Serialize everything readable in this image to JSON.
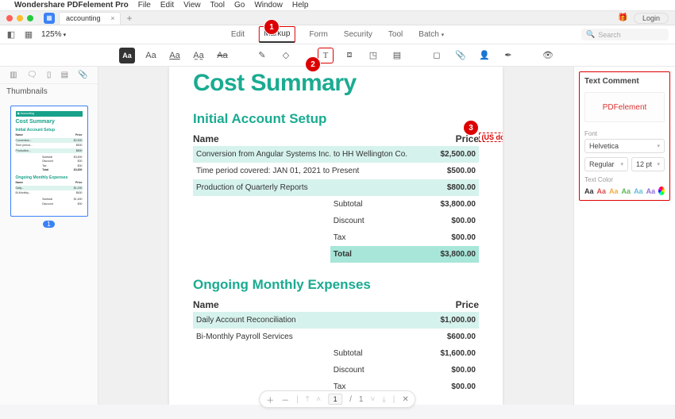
{
  "menubar": {
    "appName": "Wondershare PDFelement Pro",
    "items": [
      "File",
      "Edit",
      "View",
      "Tool",
      "Go",
      "Window",
      "Help"
    ]
  },
  "titlebar": {
    "tabName": "accounting",
    "loginLabel": "Login"
  },
  "toolbar": {
    "zoom": "125%",
    "tabs": [
      "Edit",
      "Markup",
      "Form",
      "Security",
      "Tool",
      "Batch"
    ],
    "activeTab": "Markup",
    "searchPlaceholder": "Search"
  },
  "leftPane": {
    "title": "Thumbnails",
    "pageBadge": "1"
  },
  "document": {
    "title": "Cost Summary",
    "section1": {
      "heading": "Initial Account Setup",
      "colName": "Name",
      "colPrice": "Price",
      "annotation": "(US dollar)",
      "rows": [
        {
          "name": "Conversion from Angular Systems Inc. to HH Wellington Co.",
          "price": "$2,500.00"
        },
        {
          "name": "Time period covered: JAN 01, 2021 to Present",
          "price": "$500.00"
        },
        {
          "name": "Production of Quarterly Reports",
          "price": "$800.00"
        }
      ],
      "totals": [
        {
          "label": "Subtotal",
          "value": "$3,800.00"
        },
        {
          "label": "Discount",
          "value": "$00.00"
        },
        {
          "label": "Tax",
          "value": "$00.00"
        },
        {
          "label": "Total",
          "value": "$3,800.00"
        }
      ]
    },
    "section2": {
      "heading": "Ongoing Monthly Expenses",
      "colName": "Name",
      "colPrice": "Price",
      "rows": [
        {
          "name": "Daily Account Reconciliation",
          "price": "$1,000.00"
        },
        {
          "name": "Bi-Monthly Payroll Services",
          "price": "$600.00"
        }
      ],
      "totals": [
        {
          "label": "Subtotal",
          "value": "$1,600.00"
        },
        {
          "label": "Discount",
          "value": "$00.00"
        },
        {
          "label": "Tax",
          "value": "$00.00"
        }
      ]
    }
  },
  "rightPane": {
    "title": "Text Comment",
    "sampleText": "PDFelement",
    "fontLabel": "Font",
    "fontFamily": "Helvetica",
    "fontWeight": "Regular",
    "fontSize": "12 pt",
    "colorLabel": "Text Color",
    "swatches": [
      "#333333",
      "#d9534f",
      "#f0ad4e",
      "#5cb85c",
      "#5bc0de",
      "#8e6fd9"
    ]
  },
  "pageNav": {
    "current": "1",
    "total": "1"
  },
  "callouts": {
    "c1": "1",
    "c2": "2",
    "c3": "3"
  }
}
